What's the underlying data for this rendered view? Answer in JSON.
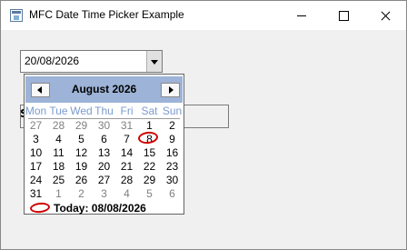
{
  "window": {
    "title": "MFC Date Time Picker Example",
    "app_icon": "app-icon",
    "controls": {
      "minimize": "minimize-icon",
      "maximize": "maximize-icon",
      "close": "close-icon"
    }
  },
  "date_picker": {
    "value": "20/08/2026",
    "dropdown_icon": "chevron-down-icon"
  },
  "partial_edit": {
    "visible_text": "S"
  },
  "calendar": {
    "month": "August",
    "year": "2026",
    "prev_icon": "arrow-left-icon",
    "next_icon": "arrow-right-icon",
    "weekdays": [
      "Mon",
      "Tue",
      "Wed",
      "Thu",
      "Fri",
      "Sat",
      "Sun"
    ],
    "weeks": [
      [
        "27",
        "28",
        "29",
        "30",
        "31",
        "1",
        "2"
      ],
      [
        "3",
        "4",
        "5",
        "6",
        "7",
        "8",
        "9"
      ],
      [
        "10",
        "11",
        "12",
        "13",
        "14",
        "15",
        "16"
      ],
      [
        "17",
        "18",
        "19",
        "20",
        "21",
        "22",
        "23"
      ],
      [
        "24",
        "25",
        "26",
        "27",
        "28",
        "29",
        "30"
      ],
      [
        "31",
        "1",
        "2",
        "3",
        "4",
        "5",
        "6"
      ]
    ],
    "selected_day": "20",
    "today_day": "8",
    "today_label": "Today: 08/08/2026",
    "colors": {
      "header_bg": "#9db3d7",
      "weekday_text": "#7b9bcf",
      "other_month_text": "#808080",
      "today_circle": "#d00000",
      "selected_bg": "#9db3d7"
    }
  }
}
